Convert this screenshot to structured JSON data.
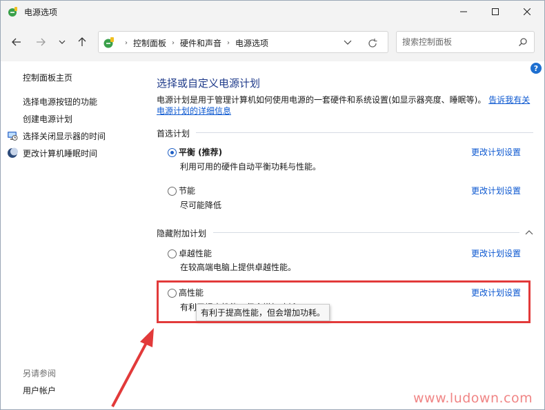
{
  "window": {
    "title": "电源选项"
  },
  "address": {
    "crumbs": [
      "控制面板",
      "硬件和声音",
      "电源选项"
    ]
  },
  "search": {
    "placeholder": "搜索控制面板"
  },
  "sidebar": {
    "home": "控制面板主页",
    "items": [
      {
        "label": "选择电源按钮的功能",
        "icon": null
      },
      {
        "label": "创建电源计划",
        "icon": null
      },
      {
        "label": "选择关闭显示器的时间",
        "icon": "monitor-clock-icon"
      },
      {
        "label": "更改计算机睡眠时间",
        "icon": "moon-icon"
      }
    ],
    "see_also": "另请参阅",
    "account": "用户帐户"
  },
  "main": {
    "heading": "选择或自定义电源计划",
    "description": "电源计划是用于管理计算机如何使用电源的一套硬件和系统设置(如显示器亮度、睡眠等)。",
    "description_link": "告诉我有关电源计划的详细信息",
    "preferred_label": "首选计划",
    "hidden_label": "隐藏附加计划",
    "plans": [
      {
        "name": "平衡 (推荐)",
        "desc": "利用可用的硬件自动平衡功耗与性能。",
        "link": "更改计划设置",
        "selected": true
      },
      {
        "name": "节能",
        "desc": "尽可能降低",
        "link": "更改计划设置",
        "selected": false
      },
      {
        "name": "卓越性能",
        "desc": "在较高端电脑上提供卓越性能。",
        "link": "更改计划设置",
        "selected": false
      },
      {
        "name": "高性能",
        "desc": "有利于提高性能，但会增加功耗。",
        "link": "更改计划设置",
        "selected": false
      }
    ],
    "tooltip": "有利于提高性能，但会增加功耗。"
  },
  "watermark": "www.ludown.com",
  "colors": {
    "link": "#0b57d0",
    "heading": "#1e3a8a",
    "highlight": "#e23a3a"
  }
}
